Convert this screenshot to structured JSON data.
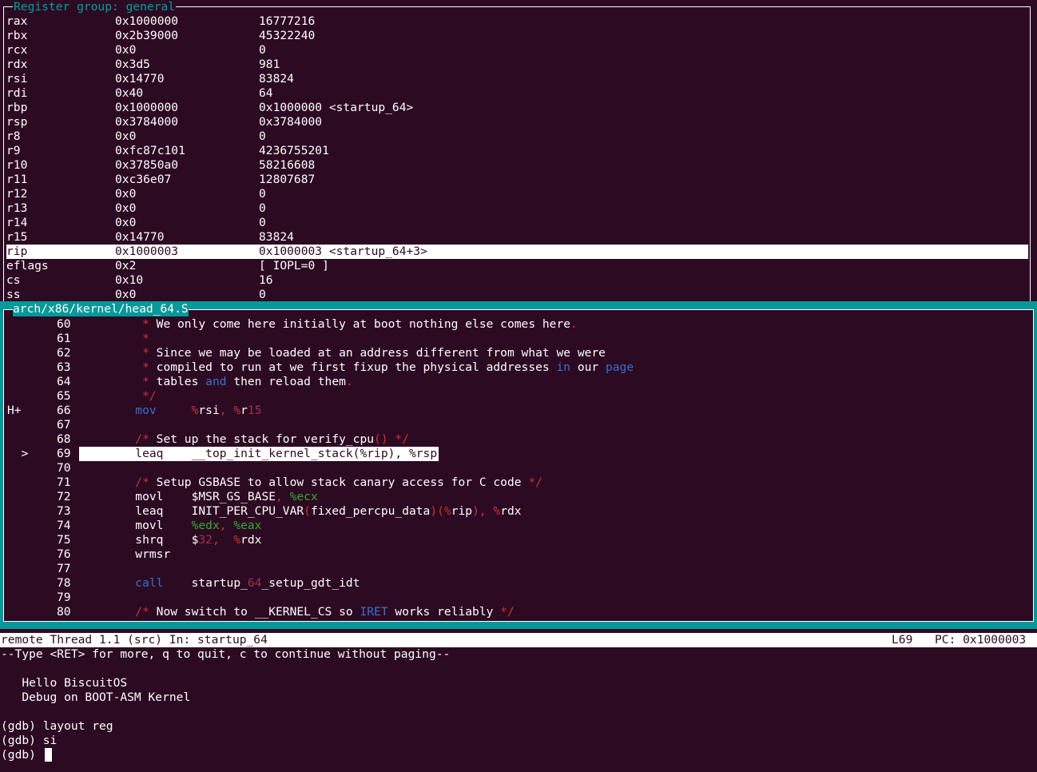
{
  "register_panel": {
    "title": "Register group: general",
    "registers": [
      {
        "name": "rax",
        "hex": "0x1000000",
        "value": "16777216"
      },
      {
        "name": "rbx",
        "hex": "0x2b39000",
        "value": "45322240"
      },
      {
        "name": "rcx",
        "hex": "0x0",
        "value": "0"
      },
      {
        "name": "rdx",
        "hex": "0x3d5",
        "value": "981"
      },
      {
        "name": "rsi",
        "hex": "0x14770",
        "value": "83824"
      },
      {
        "name": "rdi",
        "hex": "0x40",
        "value": "64"
      },
      {
        "name": "rbp",
        "hex": "0x1000000",
        "value": "0x1000000 <startup_64>"
      },
      {
        "name": "rsp",
        "hex": "0x3784000",
        "value": "0x3784000"
      },
      {
        "name": "r8",
        "hex": "0x0",
        "value": "0"
      },
      {
        "name": "r9",
        "hex": "0xfc87c101",
        "value": "4236755201"
      },
      {
        "name": "r10",
        "hex": "0x37850a0",
        "value": "58216608"
      },
      {
        "name": "r11",
        "hex": "0xc36e07",
        "value": "12807687"
      },
      {
        "name": "r12",
        "hex": "0x0",
        "value": "0"
      },
      {
        "name": "r13",
        "hex": "0x0",
        "value": "0"
      },
      {
        "name": "r14",
        "hex": "0x0",
        "value": "0"
      },
      {
        "name": "r15",
        "hex": "0x14770",
        "value": "83824"
      },
      {
        "name": "rip",
        "hex": "0x1000003",
        "value": "0x1000003 <startup_64+3>"
      },
      {
        "name": "eflags",
        "hex": "0x2",
        "value": "[ IOPL=0 ]"
      },
      {
        "name": "cs",
        "hex": "0x10",
        "value": "16"
      },
      {
        "name": "ss",
        "hex": "0x0",
        "value": "0"
      }
    ],
    "highlight_index": 16
  },
  "source_panel": {
    "title": "arch/x86/kernel/head_64.S",
    "lines": [
      {
        "marker": "",
        "num": "60",
        "segments": [
          [
            "cm",
            "* "
          ],
          [
            "txt",
            "We only come here initially at boot nothing else comes here"
          ],
          [
            "cm",
            "."
          ]
        ],
        "indent": "         "
      },
      {
        "marker": "",
        "num": "61",
        "segments": [
          [
            "cm",
            "*"
          ]
        ],
        "indent": "         "
      },
      {
        "marker": "",
        "num": "62",
        "segments": [
          [
            "cm",
            "* "
          ],
          [
            "txt",
            "Since we may be loaded at an address different from what we were"
          ]
        ],
        "indent": "         "
      },
      {
        "marker": "",
        "num": "63",
        "segments": [
          [
            "cm",
            "* "
          ],
          [
            "txt",
            "compiled to run at we first fixup the physical addresses "
          ],
          [
            "kw",
            "in"
          ],
          [
            "txt",
            " our "
          ],
          [
            "kw",
            "page"
          ]
        ],
        "indent": "         "
      },
      {
        "marker": "",
        "num": "64",
        "segments": [
          [
            "cm",
            "* "
          ],
          [
            "txt",
            "tables "
          ],
          [
            "kw",
            "and"
          ],
          [
            "txt",
            " then reload them"
          ],
          [
            "cm",
            "."
          ]
        ],
        "indent": "         "
      },
      {
        "marker": "",
        "num": "65",
        "segments": [
          [
            "cm",
            "*/"
          ]
        ],
        "indent": "         "
      },
      {
        "marker": "H+",
        "num": "66",
        "segments": [
          [
            "kw",
            "mov"
          ],
          [
            "txt",
            "     "
          ],
          [
            "reg",
            "%"
          ],
          [
            "txt",
            "rsi"
          ],
          [
            "reg",
            ", %"
          ],
          [
            "txt",
            "r"
          ],
          [
            "num",
            "15"
          ]
        ],
        "indent": "        "
      },
      {
        "marker": "",
        "num": "67",
        "segments": [],
        "indent": ""
      },
      {
        "marker": "",
        "num": "68",
        "segments": [
          [
            "cm",
            "/* "
          ],
          [
            "txt",
            "Set up the stack for verify_cpu"
          ],
          [
            "cm",
            "() */"
          ]
        ],
        "indent": "        "
      },
      {
        "marker": ">",
        "num": "69",
        "segments": [
          [
            "txt",
            "leaq    __top_init_kernel_stack(%rip), %rsp"
          ]
        ],
        "indent": "        ",
        "current": true
      },
      {
        "marker": "",
        "num": "70",
        "segments": [],
        "indent": ""
      },
      {
        "marker": "",
        "num": "71",
        "segments": [
          [
            "cm",
            "/* "
          ],
          [
            "txt",
            "Setup GSBASE to allow stack canary access for C code "
          ],
          [
            "cm",
            "*/"
          ]
        ],
        "indent": "        "
      },
      {
        "marker": "",
        "num": "72",
        "segments": [
          [
            "txt",
            "movl    $MSR_GS_BASE"
          ],
          [
            "cm",
            ", "
          ],
          [
            "grn",
            "%ecx"
          ]
        ],
        "indent": "        "
      },
      {
        "marker": "",
        "num": "73",
        "segments": [
          [
            "txt",
            "leaq    INIT_PER_CPU_VAR"
          ],
          [
            "cm",
            "("
          ],
          [
            "txt",
            "fixed_percpu_data"
          ],
          [
            "cm",
            ")(%"
          ],
          [
            "txt",
            "rip"
          ],
          [
            "cm",
            "), %"
          ],
          [
            "txt",
            "rdx"
          ]
        ],
        "indent": "        "
      },
      {
        "marker": "",
        "num": "74",
        "segments": [
          [
            "txt",
            "movl    "
          ],
          [
            "grn",
            "%edx"
          ],
          [
            "cm",
            ", "
          ],
          [
            "grn",
            "%eax"
          ]
        ],
        "indent": "        "
      },
      {
        "marker": "",
        "num": "75",
        "segments": [
          [
            "txt",
            "shrq    $"
          ],
          [
            "num",
            "32"
          ],
          [
            "cm",
            ",  %"
          ],
          [
            "txt",
            "rdx"
          ]
        ],
        "indent": "        "
      },
      {
        "marker": "",
        "num": "76",
        "segments": [
          [
            "txt",
            "wrmsr"
          ]
        ],
        "indent": "        "
      },
      {
        "marker": "",
        "num": "77",
        "segments": [],
        "indent": ""
      },
      {
        "marker": "",
        "num": "78",
        "segments": [
          [
            "kw",
            "call"
          ],
          [
            "txt",
            "    startup_"
          ],
          [
            "num",
            "64"
          ],
          [
            "txt",
            "_setup_gdt_idt"
          ]
        ],
        "indent": "        "
      },
      {
        "marker": "",
        "num": "79",
        "segments": [],
        "indent": ""
      },
      {
        "marker": "",
        "num": "80",
        "segments": [
          [
            "cm",
            "/* "
          ],
          [
            "txt",
            "Now switch to __KERNEL_CS so "
          ],
          [
            "kw",
            "IRET"
          ],
          [
            "txt",
            " works reliably "
          ],
          [
            "cm",
            "*/"
          ]
        ],
        "indent": "        "
      }
    ]
  },
  "status_bar": {
    "left": "remote Thread 1.1 (src) In: startup_64",
    "line": "L69",
    "pc": "PC: 0x1000003"
  },
  "console": {
    "lines": [
      "--Type <RET> for more, q to quit, c to continue without paging--",
      "",
      "   Hello BiscuitOS",
      "   Debug on BOOT-ASM Kernel",
      "",
      "(gdb) layout reg",
      "(gdb) si",
      "(gdb) "
    ]
  }
}
